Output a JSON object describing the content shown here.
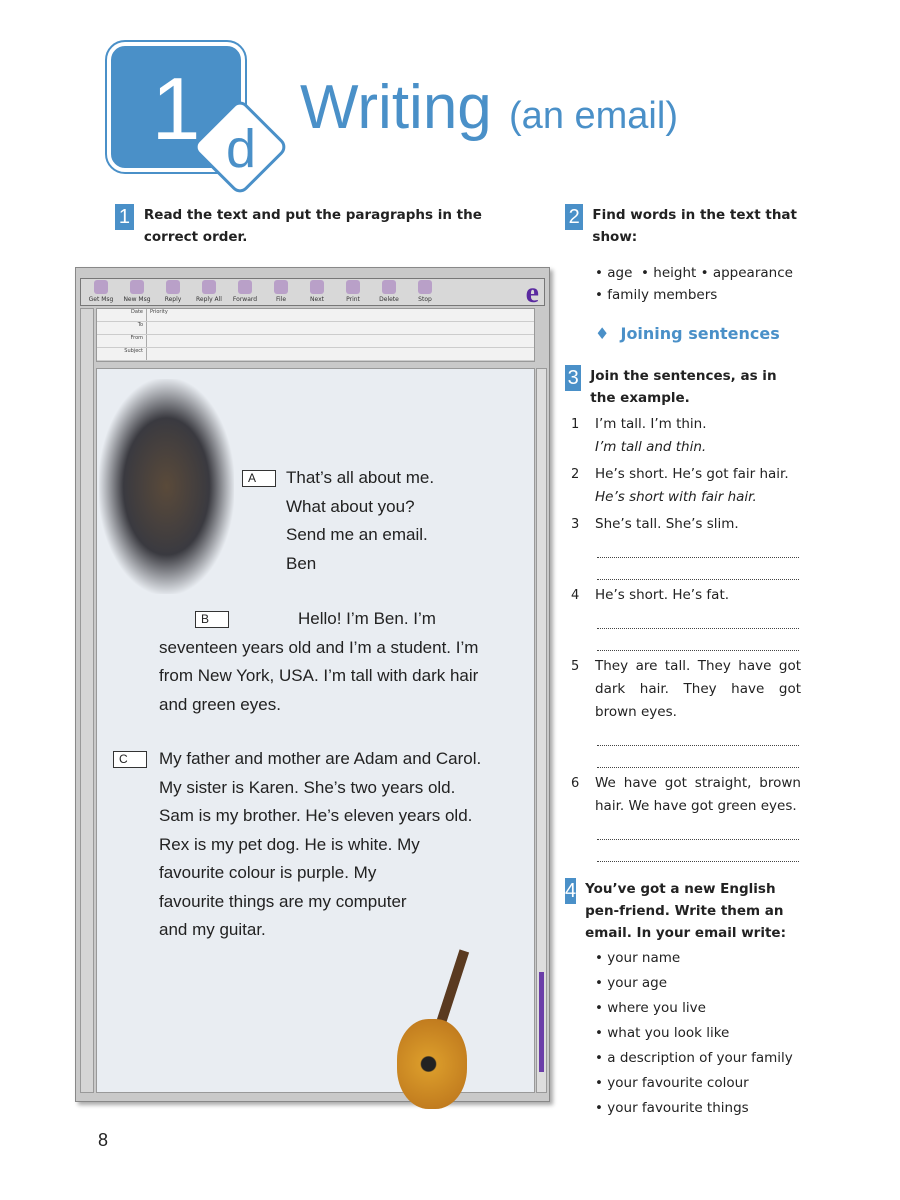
{
  "header": {
    "unit_number": "1",
    "unit_letter": "d",
    "title": "Writing",
    "subtitle": "(an email)"
  },
  "ex1": {
    "number": "1",
    "instruction": "Read the text and put the paragraphs in the correct order."
  },
  "email": {
    "toolbar": [
      "Get Msg",
      "New Msg",
      "Reply",
      "Reply All",
      "Forward",
      "File",
      "Next",
      "Print",
      "Delete",
      "Stop"
    ],
    "columns": [
      "Date",
      "Priority"
    ],
    "fields": [
      "To",
      "From",
      "Subject"
    ],
    "paragraphs": [
      {
        "label": "A",
        "lines": [
          "That’s all about me.",
          "What about you?",
          "Send me an email.",
          "Ben"
        ]
      },
      {
        "label": "B",
        "lines": [
          "Hello! I’m Ben. I’m",
          "seventeen years old and I’m a student. I’m",
          "from New York, USA. I’m tall with dark hair",
          "and green eyes."
        ]
      },
      {
        "label": "C",
        "lines": [
          "My father and mother are Adam and Carol.",
          "My sister is Karen. She’s two years old.",
          "Sam is my brother. He’s eleven years old.",
          "Rex is my pet dog. He is white. My",
          "favourite colour is purple. My",
          "favourite things are my computer",
          "and my guitar."
        ]
      }
    ]
  },
  "ex2": {
    "number": "2",
    "instruction": "Find words in the text that show:",
    "items": [
      "age",
      "height",
      "appearance",
      "family members"
    ]
  },
  "section": {
    "icon": "diamond-icon",
    "title": "Joining sentences"
  },
  "ex3": {
    "number": "3",
    "instruction": "Join the sentences, as in the example.",
    "items": [
      {
        "n": "1",
        "q": "I’m tall. I’m thin.",
        "a": "I’m tall and thin."
      },
      {
        "n": "2",
        "q": "He’s short. He’s got fair hair.",
        "a": "He’s short with fair hair."
      },
      {
        "n": "3",
        "q": "She’s tall. She’s slim."
      },
      {
        "n": "4",
        "q": "He’s short. He’s fat."
      },
      {
        "n": "5",
        "q": "They are tall. They have got dark hair. They have got brown eyes."
      },
      {
        "n": "6",
        "q": "We have got straight, brown hair. We have got green eyes."
      }
    ]
  },
  "ex4": {
    "number": "4",
    "instruction": "You’ve got a new English pen-friend. Write them an email. In your email write:",
    "items": [
      "your name",
      "your age",
      "where you live",
      "what you look like",
      "a description of your family",
      "your favourite colour",
      "your favourite things"
    ]
  },
  "page_number": "8",
  "colors": {
    "accent": "#4a90c8",
    "scrollbar": "#6b3ea8"
  }
}
